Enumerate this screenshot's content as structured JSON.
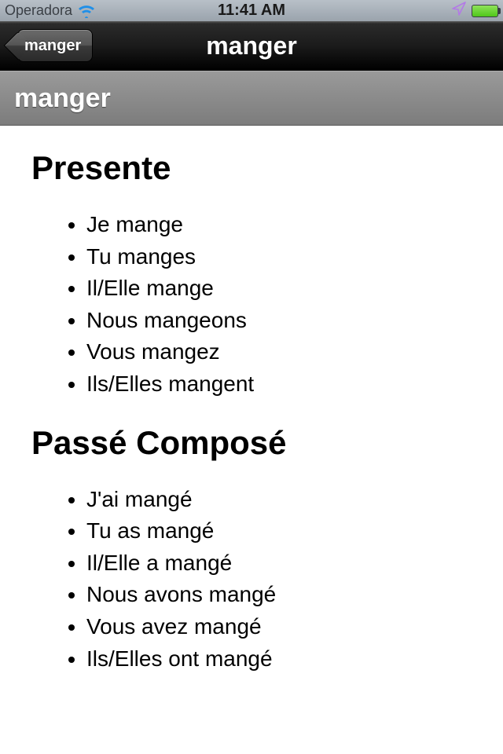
{
  "status": {
    "carrier": "Operadora",
    "time": "11:41 AM"
  },
  "nav": {
    "back_label": "manger",
    "title": "manger"
  },
  "section": {
    "header": "manger"
  },
  "tenses": [
    {
      "title": "Presente",
      "items": [
        "Je mange",
        "Tu manges",
        "Il/Elle mange",
        "Nous mangeons",
        "Vous mangez",
        "Ils/Elles mangent"
      ]
    },
    {
      "title": "Passé Composé",
      "items": [
        "J'ai mangé",
        "Tu as mangé",
        "Il/Elle a mangé",
        "Nous avons mangé",
        "Vous avez mangé",
        "Ils/Elles ont mangé"
      ]
    }
  ]
}
